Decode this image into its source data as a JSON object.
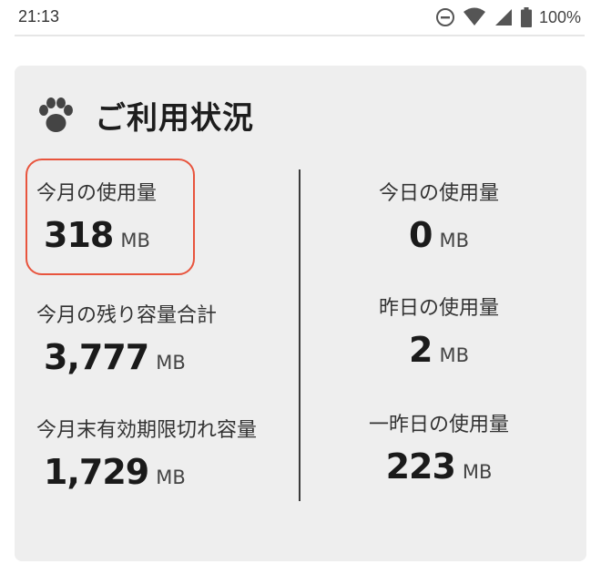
{
  "status_bar": {
    "time": "21:13",
    "battery_percent": "100%",
    "icons": [
      "do-not-disturb-icon",
      "wifi-icon",
      "cellular-signal-icon",
      "battery-icon"
    ]
  },
  "card": {
    "title": "ご利用状況",
    "icon": "paw-icon",
    "highlight_color": "#e8543d",
    "left": [
      {
        "label": "今月の使用量",
        "value": "318",
        "unit": "MB"
      },
      {
        "label": "今月の残り容量合計",
        "value": "3,777",
        "unit": "MB"
      },
      {
        "label": "今月末有効期限切れ容量",
        "value": "1,729",
        "unit": "MB"
      }
    ],
    "right": [
      {
        "label": "今日の使用量",
        "value": "0",
        "unit": "MB"
      },
      {
        "label": "昨日の使用量",
        "value": "2",
        "unit": "MB"
      },
      {
        "label": "一昨日の使用量",
        "value": "223",
        "unit": "MB"
      }
    ]
  }
}
